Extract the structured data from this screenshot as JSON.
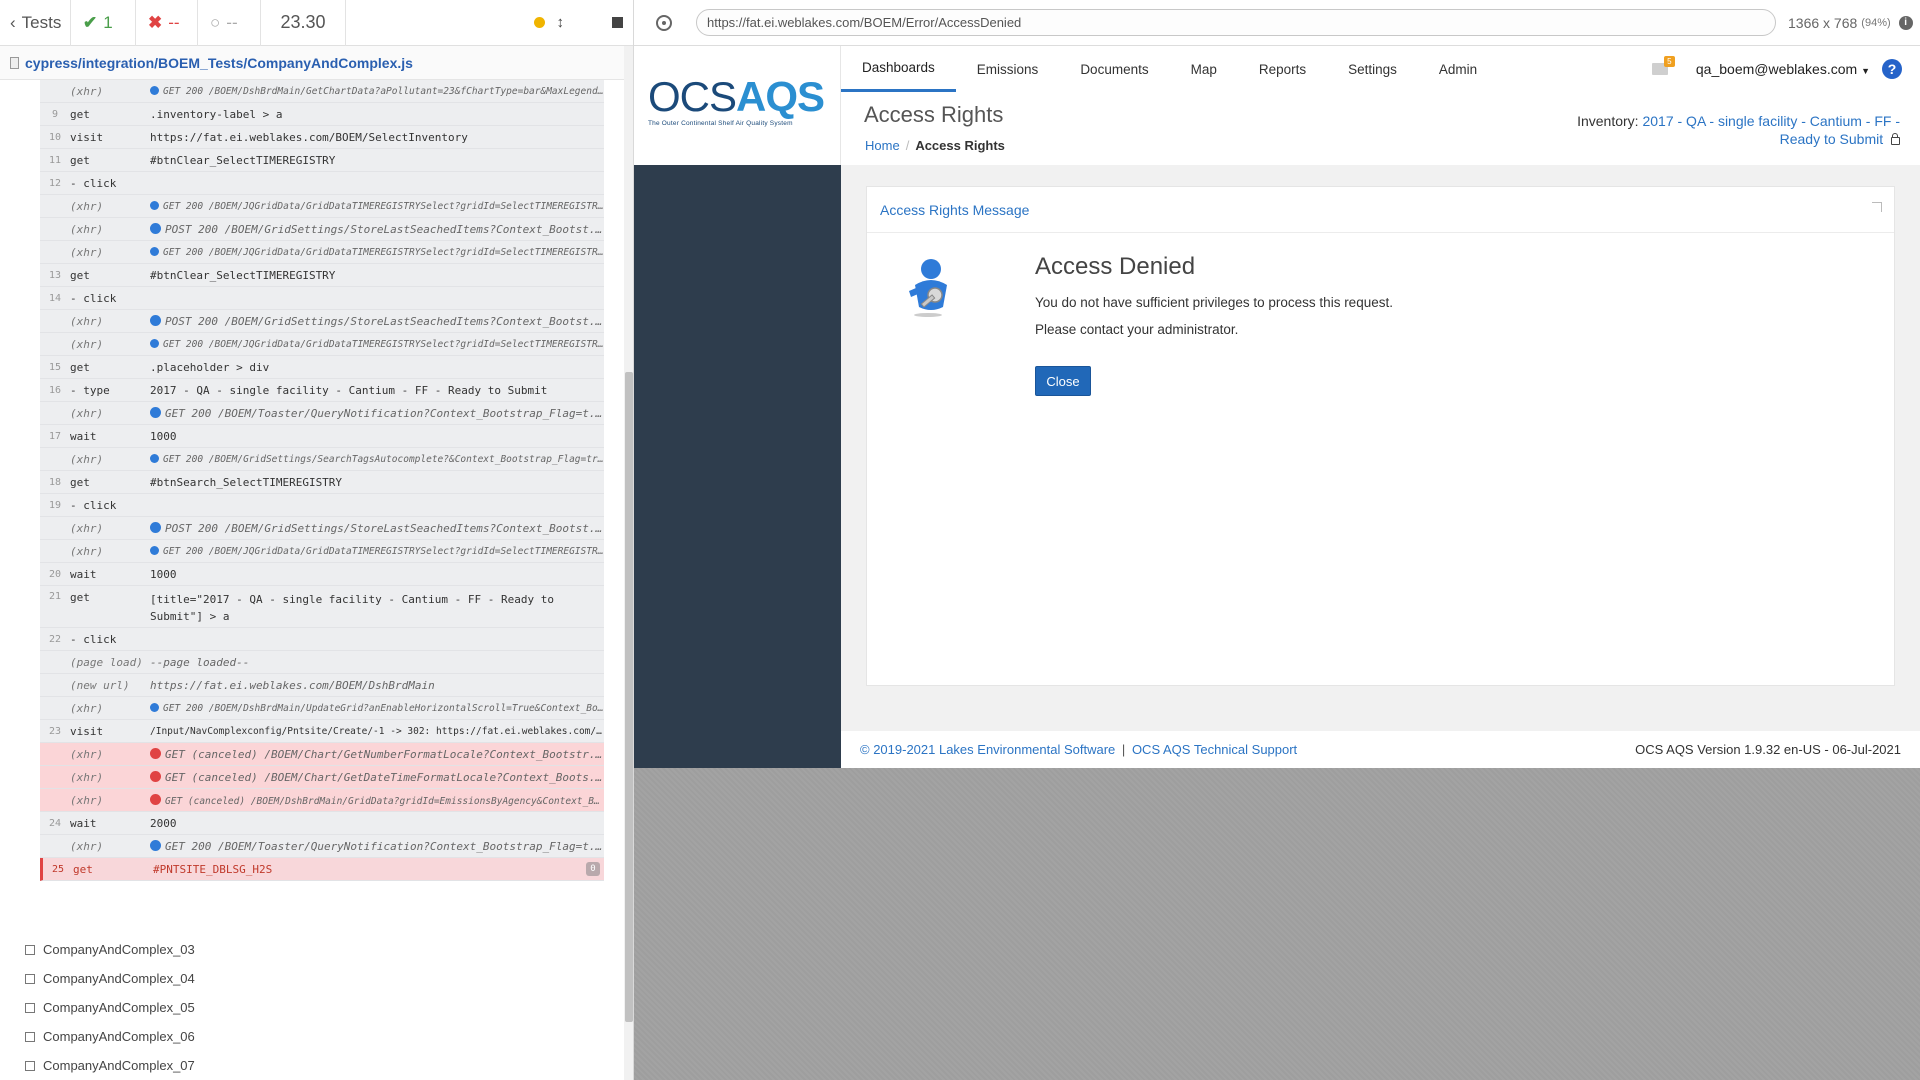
{
  "reporter": {
    "back_label": "Tests",
    "passed": "1",
    "failed": "--",
    "pending": "--",
    "duration": "23.30",
    "spec_path": "cypress/integration/BOEM_Tests/CompanyAndComplex.js",
    "commands": [
      {
        "num": "",
        "name": "(xhr)",
        "msg": "GET 200 /BOEM/DshBrdMain/GetChartData?aPollutant=23&fChartType=bar&MaxLegend...",
        "type": "xhr",
        "dot": "blue-sm",
        "small": true
      },
      {
        "num": "9",
        "name": "get",
        "msg": ".inventory-label > a",
        "type": "cmd"
      },
      {
        "num": "10",
        "name": "visit",
        "msg": "https://fat.ei.weblakes.com/BOEM/SelectInventory",
        "type": "cmd"
      },
      {
        "num": "11",
        "name": "get",
        "msg": "#btnClear_SelectTIMEREGISTRY",
        "type": "cmd"
      },
      {
        "num": "12",
        "name": " - click",
        "msg": "",
        "type": "cmd"
      },
      {
        "num": "",
        "name": "(xhr)",
        "msg": "GET 200 /BOEM/JQGridData/GridDataTIMEREGISTRYSelect?gridId=SelectTIMEREGISTR...",
        "type": "xhr",
        "dot": "blue-sm",
        "small": true
      },
      {
        "num": "",
        "name": "(xhr)",
        "msg": "POST 200 /BOEM/GridSettings/StoreLastSeachedItems?Context_Bootst...",
        "type": "xhr",
        "dot": "blue"
      },
      {
        "num": "",
        "name": "(xhr)",
        "msg": "GET 200 /BOEM/JQGridData/GridDataTIMEREGISTRYSelect?gridId=SelectTIMEREGISTR...",
        "type": "xhr",
        "dot": "blue-sm",
        "small": true
      },
      {
        "num": "13",
        "name": "get",
        "msg": "#btnClear_SelectTIMEREGISTRY",
        "type": "cmd"
      },
      {
        "num": "14",
        "name": " - click",
        "msg": "",
        "type": "cmd"
      },
      {
        "num": "",
        "name": "(xhr)",
        "msg": "POST 200 /BOEM/GridSettings/StoreLastSeachedItems?Context_Bootst...",
        "type": "xhr",
        "dot": "blue"
      },
      {
        "num": "",
        "name": "(xhr)",
        "msg": "GET 200 /BOEM/JQGridData/GridDataTIMEREGISTRYSelect?gridId=SelectTIMEREGISTR...",
        "type": "xhr",
        "dot": "blue-sm",
        "small": true
      },
      {
        "num": "15",
        "name": "get",
        "msg": ".placeholder > div",
        "type": "cmd"
      },
      {
        "num": "16",
        "name": " - type",
        "msg": "2017 - QA - single facility - Cantium - FF - Ready to Submit",
        "type": "cmd"
      },
      {
        "num": "",
        "name": "(xhr)",
        "msg": "GET 200 /BOEM/Toaster/QueryNotification?Context_Bootstrap_Flag=t...",
        "type": "xhr",
        "dot": "blue"
      },
      {
        "num": "17",
        "name": "wait",
        "msg": "1000",
        "type": "cmd"
      },
      {
        "num": "",
        "name": "(xhr)",
        "msg": "GET 200 /BOEM/GridSettings/SearchTagsAutocomplete?&Context_Bootstrap_Flag=tr...",
        "type": "xhr",
        "dot": "blue-sm",
        "small": true
      },
      {
        "num": "18",
        "name": "get",
        "msg": "#btnSearch_SelectTIMEREGISTRY",
        "type": "cmd"
      },
      {
        "num": "19",
        "name": " - click",
        "msg": "",
        "type": "cmd"
      },
      {
        "num": "",
        "name": "(xhr)",
        "msg": "POST 200 /BOEM/GridSettings/StoreLastSeachedItems?Context_Bootst...",
        "type": "xhr",
        "dot": "blue"
      },
      {
        "num": "",
        "name": "(xhr)",
        "msg": "GET 200 /BOEM/JQGridData/GridDataTIMEREGISTRYSelect?gridId=SelectTIMEREGISTR...",
        "type": "xhr",
        "dot": "blue-sm",
        "small": true
      },
      {
        "num": "20",
        "name": "wait",
        "msg": "1000",
        "type": "cmd"
      },
      {
        "num": "21",
        "name": "get",
        "msg": "[title=\"2017 - QA - single facility - Cantium - FF - Ready to Submit\"] > a",
        "type": "cmd",
        "tall": true
      },
      {
        "num": "22",
        "name": " - click",
        "msg": "",
        "type": "cmd"
      },
      {
        "num": "",
        "name": "(page load)",
        "msg": "--page loaded--",
        "type": "xhr"
      },
      {
        "num": "",
        "name": "(new url)",
        "msg": "https://fat.ei.weblakes.com/BOEM/DshBrdMain",
        "type": "xhr"
      },
      {
        "num": "",
        "name": "(xhr)",
        "msg": "GET 200 /BOEM/DshBrdMain/UpdateGrid?anEnableHorizontalScroll=True&Context_Bo...",
        "type": "xhr",
        "dot": "blue-sm",
        "small": true
      },
      {
        "num": "23",
        "name": "visit",
        "msg": "/Input/NavComplexconfig/Pntsite/Create/-1 -> 302: https://fat.ei.weblakes.com/...",
        "type": "cmd",
        "small": true
      },
      {
        "num": "",
        "name": "(xhr)",
        "msg": "GET (canceled) /BOEM/Chart/GetNumberFormatLocale?Context_Bootstr...",
        "type": "xhr",
        "dot": "red",
        "err": true
      },
      {
        "num": "",
        "name": "(xhr)",
        "msg": "GET (canceled) /BOEM/Chart/GetDateTimeFormatLocale?Context_Boots...",
        "type": "xhr",
        "dot": "red",
        "err": true
      },
      {
        "num": "",
        "name": "(xhr)",
        "msg": "GET (canceled) /BOEM/DshBrdMain/GridData?gridId=EmissionsByAgency&Context_Bo...",
        "type": "xhr",
        "dot": "red",
        "err": true,
        "small": true
      },
      {
        "num": "24",
        "name": "wait",
        "msg": "2000",
        "type": "cmd"
      },
      {
        "num": "",
        "name": "(xhr)",
        "msg": "GET 200 /BOEM/Toaster/QueryNotification?Context_Bootstrap_Flag=t...",
        "type": "xhr",
        "dot": "blue"
      },
      {
        "num": "25",
        "name": "get",
        "msg": "#PNTSITE_DBLSG_H2S",
        "type": "cmd",
        "fail": true,
        "badge": "0"
      }
    ],
    "tests": [
      "CompanyAndComplex_03",
      "CompanyAndComplex_04",
      "CompanyAndComplex_05",
      "CompanyAndComplex_06",
      "CompanyAndComplex_07"
    ]
  },
  "browser": {
    "url": "https://fat.ei.weblakes.com/BOEM/Error/AccessDenied",
    "viewport": "1366 x 768",
    "zoom": "(94%)"
  },
  "app": {
    "logo_ocs": "OCS",
    "logo_aqs": "AQS",
    "logo_tagline": "The Outer Continental Shelf Air Quality System",
    "nav": [
      "Dashboards",
      "Emissions",
      "Documents",
      "Map",
      "Reports",
      "Settings",
      "Admin"
    ],
    "mail_count": "5",
    "user": "qa_boem@weblakes.com",
    "page_title": "Access Rights",
    "breadcrumb_home": "Home",
    "breadcrumb_current": "Access Rights",
    "inventory_label": "Inventory:",
    "inventory_value": "2017 - QA - single facility - Cantium - FF - Ready to Submit",
    "card_title": "Access Rights Message",
    "deny_title": "Access Denied",
    "deny_line1": "You do not have sufficient privileges to process this request.",
    "deny_line2": "Please contact your administrator.",
    "close_label": "Close",
    "footer_copyright": "© 2019-2021 Lakes Environmental Software",
    "footer_support": "OCS AQS Technical Support",
    "footer_version": "OCS AQS Version 1.9.32 en-US - 06-Jul-2021"
  }
}
